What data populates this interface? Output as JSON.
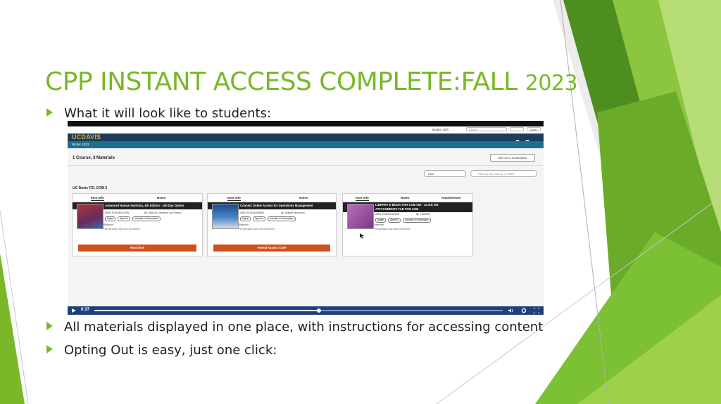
{
  "slide": {
    "title": "CPP INSTANT ACCESS COMPLETE:FALL",
    "title_year": "2023",
    "bullets": [
      "What it will look like to students:",
      "All materials displayed in one place, with instructions for accessing content",
      "Opting Out is easy, just one click:"
    ],
    "colors": {
      "accent": "#7ab829",
      "dark_green": "#4e8d1f",
      "light_green": "#9fd04a"
    }
  },
  "screenshot": {
    "find_bar": {
      "label": "Begins with",
      "placeholder": "Search",
      "done_label": "Done"
    },
    "header": {
      "logo": "UCDAVIS",
      "term": "Winter 2023",
      "colors": {
        "header": "#1c3d5a",
        "term_bar": "#1d6e8f",
        "logo": "#d8a93a"
      }
    },
    "summary": "1 Course, 3 Materials",
    "opt_out_label": "Opt Out of Subscription",
    "filter_label": "Filter",
    "search_placeholder": "Filter by title, author, or ISBN",
    "course_name": "UC Davis F21 COM 2",
    "cards": [
      {
        "tabs": [
          "Item Info",
          "Notes"
        ],
        "title": "Advanced Human Nutrition, 4th Edition - 180 Day Option",
        "isbn": "ISBN: 9781284187296",
        "author": "By: Denis M. Medeiros and Robert...",
        "chips": [
          "Digital",
          "Opted In",
          "Included in Subscription"
        ],
        "required": "Required",
        "deadline": "The last day to opt out is 01/10/2023",
        "action": "Read Now"
      },
      {
        "tabs": [
          "Item Info",
          "Notes"
        ],
        "title": "Connect Online Access for Operations Management",
        "isbn": "ISBN: 9781264058891",
        "author": "By: William Stevenson",
        "chips": [
          "Digital",
          "Opted In",
          "Included in Subscription"
        ],
        "required": "Required",
        "deadline": "The last day to opt out is 01/10/2023",
        "action": "Reveal Access Code"
      },
      {
        "tabs": [
          "Item Info",
          "Notes",
          "Attachments"
        ],
        "title": "LIBRARY E-BOOK FOR COM 002 - CLICK ON ATTACHMENTS TAB FOR LINK",
        "isbn": "ISBN: 9780000000000",
        "author": "By: LIBRARY",
        "chips": [
          "Digital",
          "Opted In",
          "Included in Subscription"
        ],
        "required": "Required",
        "deadline": "The last day to opt out is 01/10/2023",
        "action": ""
      }
    ],
    "video": {
      "time": "0:37",
      "progress": 0.55,
      "colors": {
        "bar": "#1d3f7a"
      }
    },
    "colors": {
      "action_button": "#d0501d"
    }
  }
}
